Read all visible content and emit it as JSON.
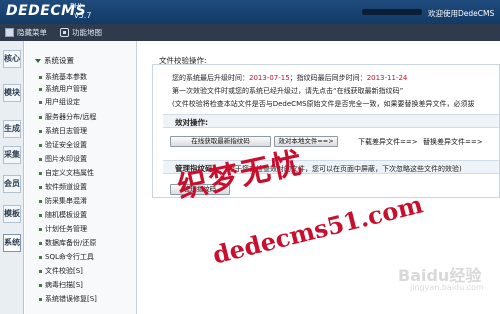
{
  "header": {
    "logo": "DEDECMS",
    "version_top": "PHI",
    "version": "v5.7",
    "welcome": "欢迎使用DedeCMS"
  },
  "toolbar": {
    "hide_menu": "隐藏菜单",
    "function_map": "功能地图"
  },
  "vtabs": [
    "核心",
    "模块",
    "生成",
    "采集",
    "会员",
    "模板",
    "系统"
  ],
  "sidebar": {
    "title": "系统设置",
    "items": [
      "系统基本参数",
      "系统用户管理",
      "用户组设定",
      "服务器分布/远程",
      "系统日志管理",
      "验证安全设置",
      "图片水印设置",
      "自定义文档属性",
      "软件频道设置",
      "防采集串混淆",
      "随机模板设置",
      "计划任务管理",
      "数据库备份/还原",
      "SQL命令行工具",
      "文件校验[S]",
      "病毒扫描[S]",
      "系统错误修复[S]"
    ]
  },
  "main": {
    "section_title": "文件校验操作:",
    "line1_prefix": "您的系统最后升级时间：",
    "line1_date1": "2013-07-15",
    "line1_mid": "；指纹码最后同步时间：",
    "line1_date2": "2013-11-24",
    "line2": "第一次效验文件时或您的系统已经升级过，请先点击“在线获取最新指纹码”",
    "line3": "(文件校验将检查本站文件是否与DedeCMS原始文件是否完全一致，如果要替换差异文件，必须拔",
    "verify_label": "效对操作:",
    "btn_fetch": "在线获取最新指纹码",
    "btn_local": "效对本地文件==>",
    "link_download": "下载差异文件==>",
    "link_replace": "替换差异文件==>",
    "manage_label": "管理指纹码:",
    "manage_text": "用于您在检查效对的文件，您可以在页面中屏蔽，下次忽略这些文件的效验)",
    "btn_manage": "管理指纹码"
  },
  "watermark": {
    "chinese": "织梦无忧",
    "domain": "dedecms51.com",
    "site": "Baidu经验",
    "site2": "jingyan.baidu.com"
  }
}
